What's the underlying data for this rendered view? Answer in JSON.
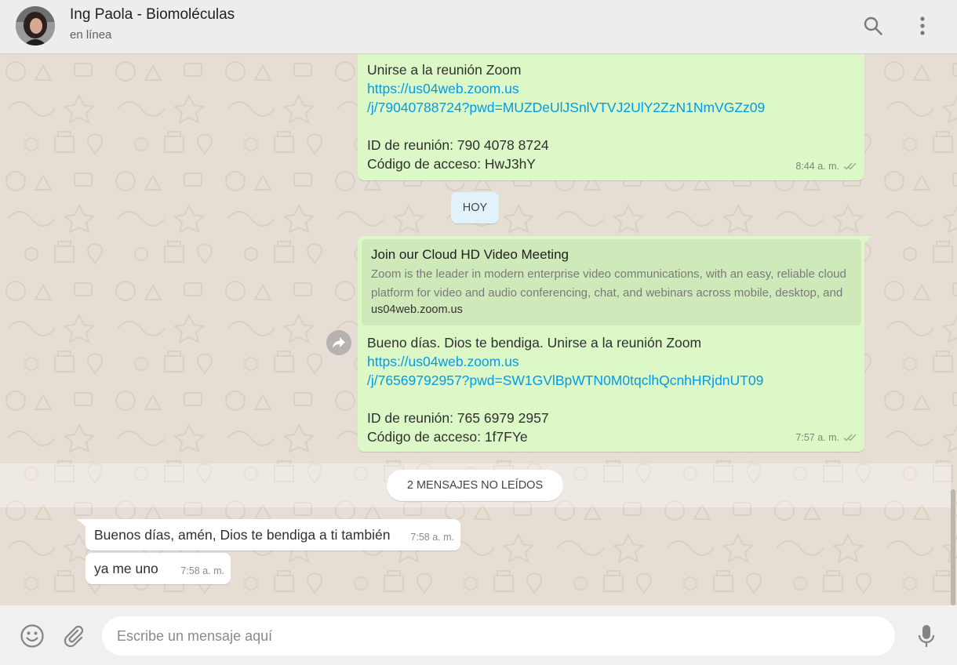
{
  "header": {
    "contact_name": "Ing Paola - Biomoléculas",
    "status": "en línea",
    "icons": [
      "search-icon",
      "menu-icon"
    ]
  },
  "messages": {
    "m1": {
      "line1": "Unirse a la reunión Zoom",
      "link1": "https://us04web.zoom.us",
      "link2": "/j/79040788724?pwd=MUZDeUlJSnlVTVJ2UlY2ZzN1NmVGZz09",
      "line3": "ID de reunión: 790 4078 8724",
      "line4": "Código de acceso: HwJ3hY",
      "time": "8:44 a. m."
    },
    "date_divider": "HOY",
    "m2": {
      "preview_title": "Join our Cloud HD Video Meeting",
      "preview_desc": "Zoom is the leader in modern enterprise video communications, with an easy, reliable cloud platform for video and audio conferencing, chat, and webinars across mobile, desktop, and",
      "preview_domain": "us04web.zoom.us",
      "line1": "Bueno días. Dios te bendiga. Unirse a la reunión Zoom",
      "link1": "https://us04web.zoom.us",
      "link2": "/j/76569792957?pwd=SW1GVlBpWTN0M0tqclhQcnhHRjdnUT09",
      "line3": "ID de reunión: 765 6979 2957",
      "line4": "Código de acceso: 1f7FYe",
      "time": "7:57 a. m."
    },
    "unread_divider": "2 MENSAJES NO LEÍDOS",
    "m3": {
      "text": "Buenos días, amén, Dios te bendiga a ti también",
      "time": "7:58 a. m."
    },
    "m4": {
      "text": "ya me uno",
      "time": "7:58 a. m."
    }
  },
  "footer": {
    "placeholder": "Escribe un mensaje aquí",
    "icons": [
      "emoji-icon",
      "attach-icon",
      "mic-icon"
    ]
  },
  "colors": {
    "outgoing_bubble": "#dcf8c6",
    "incoming_bubble": "#ffffff",
    "link": "#039be5",
    "chat_background": "#e6ddd4",
    "read_ticks": "#8fa88f"
  }
}
